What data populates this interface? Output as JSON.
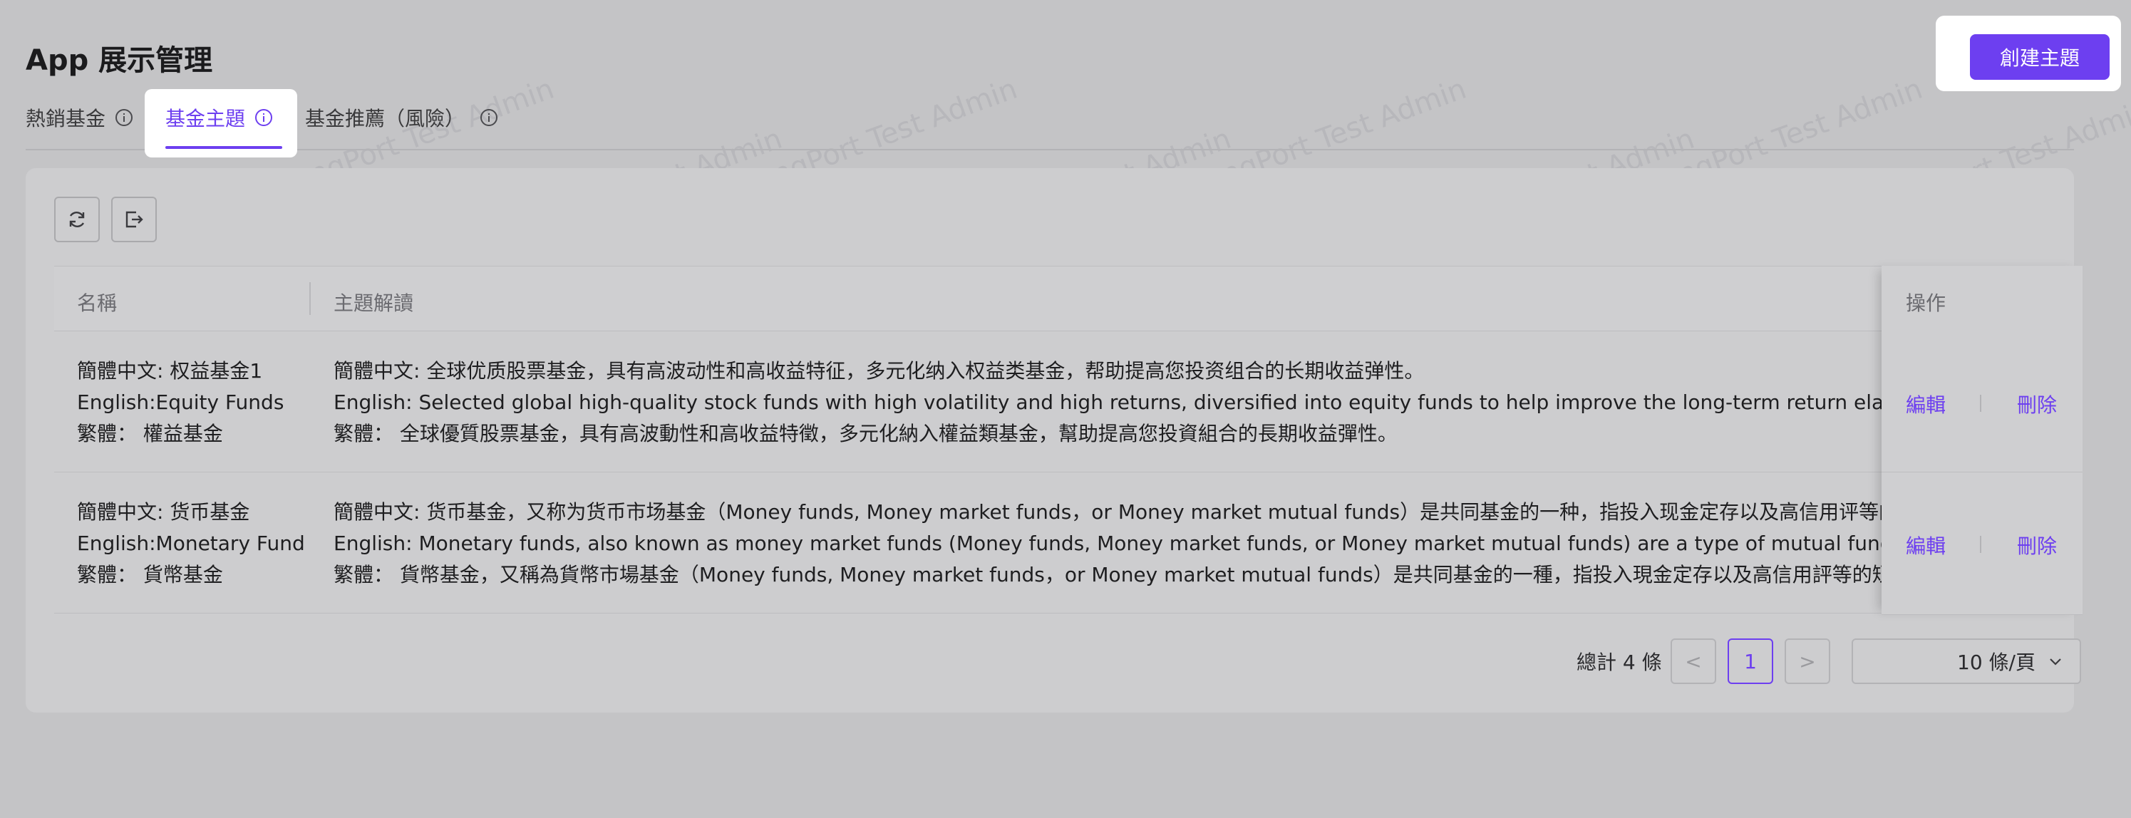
{
  "page": {
    "title": "App 展示管理",
    "create_button": "創建主題"
  },
  "tabs": [
    {
      "label": "熱銷基金",
      "active": false
    },
    {
      "label": "基金主題",
      "active": true
    },
    {
      "label": "基金推薦（風險）",
      "active": false
    }
  ],
  "toolbar": {
    "refresh_icon": "refresh-icon",
    "export_icon": "export-icon"
  },
  "table": {
    "columns": [
      "名稱",
      "主題解讀",
      "操作"
    ],
    "rows": [
      {
        "name": [
          "簡體中文: 权益基金1",
          "English:Equity Funds",
          "繁體：  權益基金"
        ],
        "theme": [
          "簡體中文: 全球优质股票基金，具有高波动性和高收益特征，多元化纳入权益类基金，帮助提高您投资组合的长期收益弹性。",
          "English: Selected global high-quality stock funds with high volatility and high returns, diversified into equity funds to help improve the long-term return elasticity of your investment portfolio.",
          "繁體：  全球優質股票基金，具有高波動性和高收益特徵，多元化納入權益類基金，幫助提高您投資組合的長期收益彈性。"
        ],
        "edit": "編輯",
        "delete": "刪除"
      },
      {
        "name": [
          "簡體中文: 货币基金",
          "English:Monetary Fund",
          "繁體：  貨幣基金"
        ],
        "theme": [
          "簡體中文: 货币基金，又称为货币市场基金（Money funds, Money market funds，or Money market mutual funds）是共同基金的一种，指投入现金定存以及高信用评等的短期票券",
          "English: Monetary funds, also known as money market funds (Money funds, Money market funds, or Money market mutual funds) are a type of mutual funds, which refer to",
          "繁體：  貨幣基金，又稱為貨幣市場基金（Money funds, Money market funds，or Money market mutual funds）是共同基金的一種，指投入現金定存以及高信用評等的短期票券"
        ],
        "edit": "編輯",
        "delete": "刪除"
      }
    ]
  },
  "pagination": {
    "total": "總計 4 條",
    "current_page": "1",
    "prev": "<",
    "next": ">",
    "page_size": "10 條/頁"
  },
  "watermark": "LongPort Test Admin",
  "colors": {
    "accent": "#6d3ff0",
    "background": "#c4c4c6"
  }
}
